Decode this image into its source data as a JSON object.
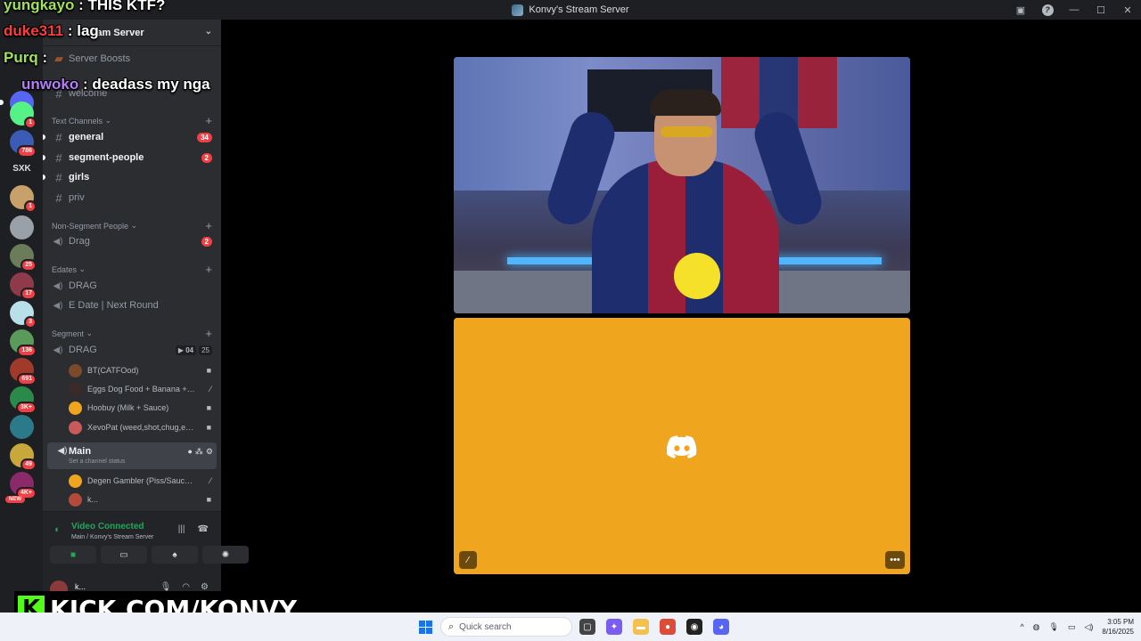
{
  "window": {
    "title": "Konvy's Stream Server"
  },
  "server": {
    "name_partial": "ream Server",
    "boosts_label": "Server Boosts",
    "welcome": "welcome"
  },
  "rail": {
    "badges": [
      "1",
      "786",
      "1",
      "25",
      "17",
      "3",
      "136",
      "691",
      "3K+",
      "49",
      "4K+"
    ],
    "sxk": "SXK",
    "new_label": "NEW"
  },
  "categories": {
    "text": "Text Channels",
    "non_segment": "Non-Segment People",
    "edates": "Edates",
    "segment": "Segment"
  },
  "text_channels": [
    {
      "name": "general",
      "mentions": "34"
    },
    {
      "name": "segment-people",
      "mentions": "2"
    },
    {
      "name": "girls",
      "mentions": ""
    },
    {
      "name": "priv",
      "mentions": ""
    }
  ],
  "non_segment_channels": [
    {
      "name": "Drag",
      "mentions": "2"
    }
  ],
  "edates_channels": [
    {
      "name": "DRAG"
    },
    {
      "name": "E Date | Next Round"
    }
  ],
  "segment_drag": {
    "name": "DRAG",
    "cams": "04",
    "count": "25"
  },
  "drag_users": [
    "BT(CATFOod)",
    "Eggs Dog Food + Banana + M...",
    "Hoobuy (Milk + Sauce)",
    "XevoPat (weed,shot,chug,ex..."
  ],
  "main_channel": {
    "name": "Main",
    "status": "Set a channel status"
  },
  "main_users": [
    "Degen Gambler (Piss/Sauce ...",
    "k..."
  ],
  "voice": {
    "status": "Video Connected",
    "location": "Main / Konvy's Stream Server"
  },
  "userbar": {
    "name": "k..."
  },
  "chat": [
    {
      "user": "yungkayo",
      "msg": ": THIS KTF?",
      "color": "#9ee35a"
    },
    {
      "user": "duke311",
      "msg": ": lag",
      "color": "#ff3b3b"
    },
    {
      "user": "Purq",
      "msg": ":",
      "color": "#9ee35a"
    },
    {
      "user": "unwoko",
      "msg": ": deadass my nga",
      "color": "#b47cff"
    }
  ],
  "kick": {
    "letter": "K",
    "url": "KICK.COM/KONVY"
  },
  "taskbar": {
    "search_placeholder": "Quick search",
    "time": "3:05 PM",
    "date": "8/16/2025"
  },
  "colors": {
    "accent_green": "#23a55a",
    "mention_red": "#f23f43",
    "orange_tile": "#f0a51f",
    "kick_green": "#53fc18"
  },
  "icons": [
    "signal-icon",
    "hangup-icon",
    "camera-icon",
    "screenshare-icon",
    "activity-icon",
    "soundboard-icon",
    "discord-logo-icon",
    "mute-icon",
    "more-icon"
  ]
}
